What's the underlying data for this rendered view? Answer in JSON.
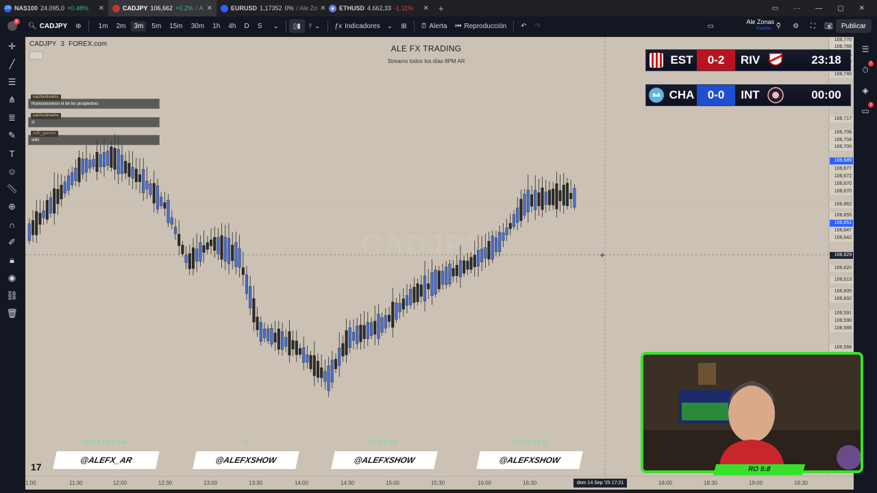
{
  "browser": {
    "tabs": [
      {
        "symbol": "NAS100",
        "price": "24.095,0",
        "change": "+0.48%",
        "dir": "up",
        "fav_color": "#2962ff"
      },
      {
        "symbol": "CADJPY",
        "price": "106,662",
        "change": "+0.2%",
        "dir": "up",
        "fav_color": "#c0392b",
        "suffix": "/ A"
      },
      {
        "symbol": "EURUSD",
        "price": "1,17352",
        "change": "0%",
        "dir": "flat",
        "fav_color": "#2962ff",
        "suffix": "/ Ale Zo"
      },
      {
        "symbol": "ETHUSD",
        "price": "4.662,33",
        "change": "-1.11%",
        "dir": "down",
        "fav_color": "#627eea"
      }
    ],
    "new_tab": "+"
  },
  "toolbar": {
    "badge": "8",
    "symbol": "CADJPY",
    "timeframes": [
      "1m",
      "2m",
      "3m",
      "5m",
      "15m",
      "30m",
      "1h",
      "4h",
      "D",
      "S"
    ],
    "active_timeframe": "3m",
    "indicators_label": "Indicadores",
    "alert_label": "Alerta",
    "replay_label": "Reproducción",
    "user_name": "Ale Zonas",
    "user_sub": "Guardar",
    "publish_label": "Publicar"
  },
  "chart": {
    "symbol": "CADJPY",
    "interval": "3",
    "exchange": "FOREX.com",
    "title": "ALE FX TRADING",
    "subtitle": "Streams todos los días 8PM AR",
    "watermark": "CADJPY",
    "chat": [
      {
        "user": "nachostreams",
        "message": "Nooooooooooo el de los picapiedras"
      },
      {
        "user": "nachostreams",
        "message": "si"
      },
      {
        "user": "sofii_gamerx",
        "message": "siiiiii"
      }
    ]
  },
  "price_axis": {
    "labels": [
      {
        "price": "106,770"
      },
      {
        "price": "106,766"
      },
      {
        "price": "106,756"
      },
      {
        "price": "106,748"
      },
      {
        "price": "106,740"
      },
      {
        "price": "106,717"
      },
      {
        "price": "106,706"
      },
      {
        "price": "106,704"
      },
      {
        "price": "106,700"
      },
      {
        "price": "106,689",
        "style": "hl"
      },
      {
        "price": "106,677"
      },
      {
        "price": "106,672"
      },
      {
        "price": "106,670"
      },
      {
        "price": "106,670"
      },
      {
        "price": "106,662"
      },
      {
        "price": "106,655"
      },
      {
        "price": "106,651",
        "style": "hl"
      },
      {
        "price": "106,647"
      },
      {
        "price": "106,642"
      },
      {
        "price": "106,629",
        "style": "cur"
      },
      {
        "price": "106,620"
      },
      {
        "price": "106,613"
      },
      {
        "price": "106,605"
      },
      {
        "price": "106,602"
      },
      {
        "price": "106,591"
      },
      {
        "price": "106,590"
      },
      {
        "price": "106,588"
      },
      {
        "price": "106,568"
      }
    ]
  },
  "time_axis": {
    "labels": [
      "1:00",
      "11:30",
      "12:00",
      "12:30",
      "13:00",
      "13:30",
      "14:00",
      "14:30",
      "15:00",
      "15:30",
      "16:00",
      "16:30",
      "18:00",
      "18:30",
      "19:00",
      "19:30"
    ],
    "cursor_label": "dom 14 Sep '25   17:21"
  },
  "scoreboards": [
    {
      "home": "EST",
      "score": "0-2",
      "away": "RIV",
      "clock": "23:18",
      "score_color": "red"
    },
    {
      "home": "CHA",
      "score": "0-0",
      "away": "INT",
      "clock": "00:00",
      "score_color": "blue"
    }
  ],
  "social": [
    {
      "platform": "INSTAGRAM",
      "handle": "@ALEFX_AR"
    },
    {
      "platform": "X",
      "handle": "@ALEFXSHOW"
    },
    {
      "platform": "TIKTOK",
      "handle": "@ALEFXSHOW"
    },
    {
      "platform": "YOUTUBE",
      "handle": "@ALEFXSHOW"
    }
  ],
  "webcam": {
    "label": "RO 5:8"
  },
  "tv_logo": "17"
}
